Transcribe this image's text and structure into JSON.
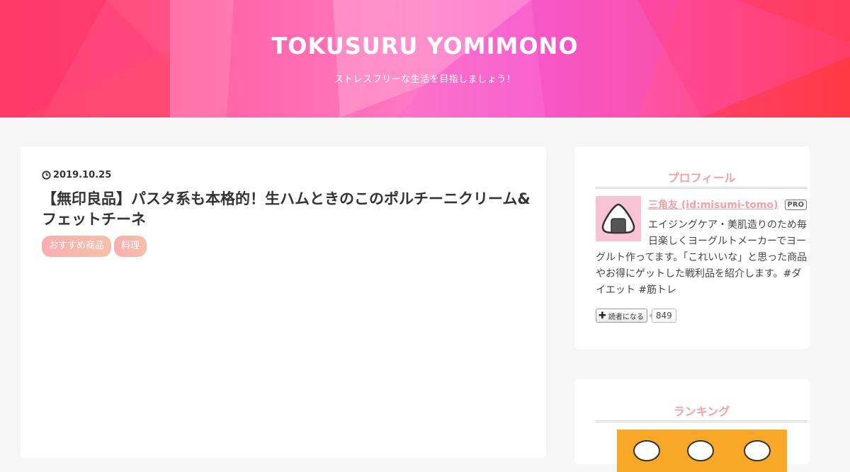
{
  "header": {
    "site_title": "TOKUSURU YOMIMONO",
    "site_description": "ストレスフリーな生活を目指しましょう！"
  },
  "article": {
    "date": "2019.10.25",
    "title": "【無印良品】パスタ系も本格的！生ハムときのこのポルチーニクリーム&フェットチーネ",
    "categories": [
      "おすすめ商品",
      "料理"
    ]
  },
  "sidebar": {
    "profile": {
      "heading": "プロフィール",
      "name": "三角友 (id:misumi-tomo)",
      "badge": "PRO",
      "description": "エイジングケア・美肌造りのため毎日楽しくヨーグルトメーカーでヨーグルト作ってます。「これいいな」と思った商品やお得にゲットした戦利品を紹介します。#ダイエット #筋トレ",
      "reader_button": "読者になる",
      "reader_count": "849"
    },
    "ranking": {
      "heading": "ランキング"
    }
  },
  "colors": {
    "accent_pink": "#f4a0a6",
    "category_gradient_start": "#f7aeb0",
    "category_gradient_end": "#f5c0a8",
    "header_gradient": [
      "#ff4a7a",
      "#ff78c4",
      "#f85fcf",
      "#ff4048"
    ],
    "ranking_banner": "#f8a826"
  },
  "icons": {
    "date": "clock-icon",
    "avatar": "onigiri-icon",
    "reader_button": "plus-icon"
  }
}
